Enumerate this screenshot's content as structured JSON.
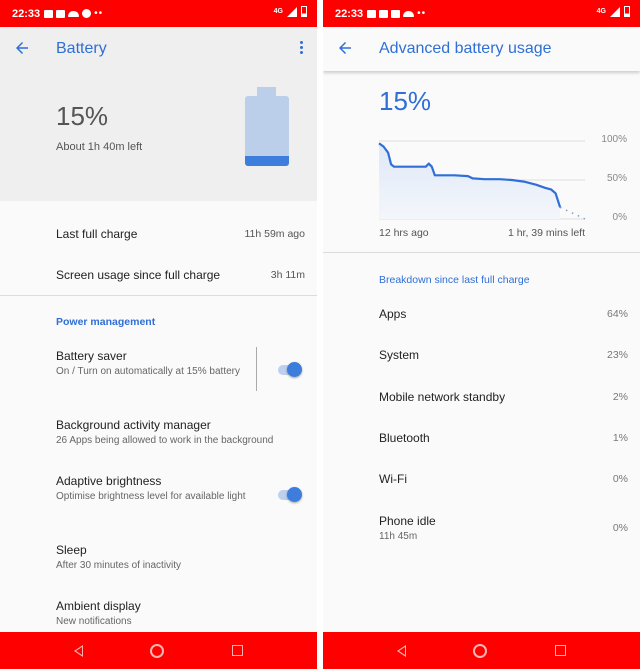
{
  "statusbar": {
    "time": "22:33",
    "network": "4G"
  },
  "left": {
    "title": "Battery",
    "battery_percent": "15%",
    "battery_level": 0.15,
    "time_left": "About 1h 40m left",
    "info_rows": [
      {
        "title": "Last full charge",
        "value": "11h 59m ago"
      },
      {
        "title": "Screen usage since full charge",
        "value": "3h 11m"
      }
    ],
    "section_header": "Power management",
    "settings": [
      {
        "title": "Battery saver",
        "subtitle": "On / Turn on automatically at 15% battery",
        "toggle": true
      },
      {
        "title": "Background activity manager",
        "subtitle": "26 Apps being allowed to work in the background"
      },
      {
        "title": "Adaptive brightness",
        "subtitle": "Optimise brightness level for available light",
        "toggle": true
      },
      {
        "title": "Sleep",
        "subtitle": "After 30 minutes of inactivity"
      },
      {
        "title": "Ambient display",
        "subtitle": "New notifications"
      }
    ]
  },
  "right": {
    "title": "Advanced battery usage",
    "battery_percent": "15%",
    "section_header": "Breakdown since last full charge",
    "breakdown": [
      {
        "title": "Apps",
        "value": "64%"
      },
      {
        "title": "System",
        "value": "23%"
      },
      {
        "title": "Mobile network standby",
        "value": "2%"
      },
      {
        "title": "Bluetooth",
        "value": "1%"
      },
      {
        "title": "Wi-Fi",
        "value": "0%"
      },
      {
        "title": "Phone idle",
        "subtitle": "11h 45m",
        "value": "0%"
      }
    ]
  },
  "chart_data": {
    "type": "line",
    "title": "",
    "xlabel_start": "12 hrs ago",
    "xlabel_end": "1 hr, 39 mins left",
    "y_ticks": [
      "100%",
      "50%",
      "0%"
    ],
    "ylim": [
      0,
      100
    ],
    "x_range_hours": [
      -12,
      1.65
    ],
    "series": [
      {
        "name": "battery history",
        "style": "solid",
        "x": [
          -12,
          -11.7,
          -11.4,
          -11.2,
          -11.0,
          -10.5,
          -9.5,
          -8.9,
          -8.7,
          -8.5,
          -8.3,
          -8.0,
          -7.0,
          -6.1,
          -5.8,
          -5.0,
          -4.0,
          -3.2,
          -2.4,
          -1.6,
          -1.0,
          -0.6,
          -0.3,
          0
        ],
        "y": [
          97,
          93,
          85,
          70,
          67,
          67,
          67,
          67,
          71,
          67,
          56,
          56,
          56,
          55,
          52,
          51,
          51,
          50,
          48,
          44,
          40,
          38,
          33,
          15
        ]
      },
      {
        "name": "prediction",
        "style": "dotted",
        "x": [
          0,
          1.65
        ],
        "y": [
          15,
          0
        ]
      }
    ],
    "grid": true
  },
  "colors": {
    "accent": "#2f6fd6",
    "statusbar": "#ff0000",
    "battery_light": "#bccfea",
    "battery_fill": "#3d7ddb"
  }
}
